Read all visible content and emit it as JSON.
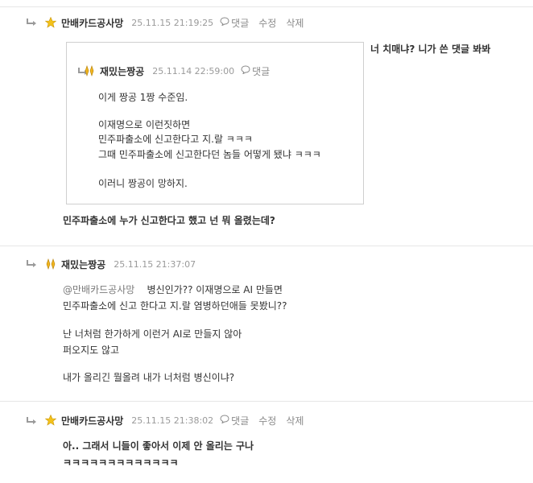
{
  "colors": {
    "accent": "#e0531d",
    "muted": "#9a9a9a",
    "divider": "#e6e6e6"
  },
  "comment1": {
    "author": "만배카드공사망",
    "time": "25.11.15 21:19:25",
    "reply_label": "댓글",
    "edit_label": "수정",
    "delete_label": "삭제",
    "side_note": "너 치매냐? 니가 쓴 댓글 봐봐",
    "quote": {
      "author": "재밌는짱공",
      "time": "25.11.14 22:59:00",
      "reply_label": "댓글",
      "lines": [
        "이게 짱공 1짱 수준임.",
        "이재명으로 이런짓하면",
        "민주파출소에 신고한다고 지.랄 ㅋㅋㅋ",
        "그때 민주파출소에 신고한다던 놈들 어떻게 됐냐 ㅋㅋㅋ",
        "이러니 짱공이 망하지."
      ]
    },
    "body_orange": "민주파출소에 누가 신고한다고 했고 넌 뭐 올렸는데?"
  },
  "comment2": {
    "author": "재밌는짱공",
    "time": "25.11.15 21:37:07",
    "mention": "@만배카드공사망",
    "lines": [
      "병신인가?? 이재명으로 AI 만들면",
      "민주파출소에 신고 한다고 지.랄 염병하던애들 못봤니??",
      "난 너처럼 한가하게 이런거 AI로 만들지 않아",
      "퍼오지도 않고",
      "내가 올리긴 뭘올려 내가 너처럼 병신이냐?"
    ]
  },
  "comment3": {
    "author": "만배카드공사망",
    "time": "25.11.15 21:38:02",
    "reply_label": "댓글",
    "edit_label": "수정",
    "delete_label": "삭제",
    "lines_orange": [
      "아.. 그래서 니들이 좋아서 이제 안 올리는 구나",
      "ㅋㅋㅋㅋㅋㅋㅋㅋㅋㅋㅋㅋㅋ"
    ]
  },
  "icons": {
    "reply_arrow": "reply-arrow-icon",
    "star_badge": "star-badge-icon",
    "gold_badge": "gold-badge-icon",
    "speech": "speech-bubble-icon"
  }
}
